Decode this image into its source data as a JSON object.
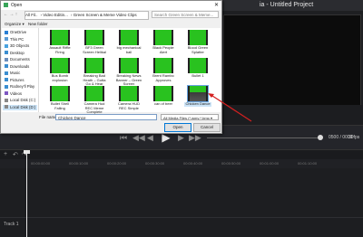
{
  "editor": {
    "title": "ia - Untitled Project",
    "timecode": "0500 / 0000",
    "speed": "30fps",
    "track_label": "Track 1",
    "ruler": [
      "00:00:00:00",
      "00:00:10:00",
      "00:00:20:00",
      "00:00:30:00",
      "00:00:40:00",
      "00:00:50:00",
      "00:01:00:00",
      "00:01:10:00"
    ]
  },
  "dialog": {
    "title": "Open",
    "address": [
      "All Fil..",
      "Video Editin...",
      "Green Screen & Meme Video Clips"
    ],
    "search_placeholder": "Search Green Screen & Meme...",
    "organize": "Organize ▾",
    "new_folder": "New folder",
    "nav": [
      {
        "label": "OneDrive",
        "color": "#2a7fd4"
      },
      {
        "label": "This PC",
        "color": "#5b9bd5"
      },
      {
        "label": "3D Objects",
        "color": "#4aa3df"
      },
      {
        "label": "Desktop",
        "color": "#3b8ed0"
      },
      {
        "label": "Documents",
        "color": "#6b8ebc"
      },
      {
        "label": "Downloads",
        "color": "#3b8ed0"
      },
      {
        "label": "Music",
        "color": "#3b8ed0"
      },
      {
        "label": "Pictures",
        "color": "#3b8ed0"
      },
      {
        "label": "Rodney'll Play",
        "color": "#3b8ed0"
      },
      {
        "label": "Videos",
        "color": "#7e57c2"
      },
      {
        "label": "Local Disk (C:)",
        "color": "#888888"
      },
      {
        "label": "Local Disk (D:)",
        "color": "#888888"
      }
    ],
    "files": [
      {
        "name": "Assault Riffle Firing",
        "person": false
      },
      {
        "name": "BF3 Green Screen Helikal",
        "person": false
      },
      {
        "name": "big mechanical ball",
        "person": false
      },
      {
        "name": "Black People Alert",
        "person": false
      },
      {
        "name": "Blood Green Splatter",
        "person": false
      },
      {
        "name": "Bus Bomb explosion",
        "person": false
      },
      {
        "name": "Breaking Bad Heath – Gotta Go & Hear",
        "person": false
      },
      {
        "name": "Breaking News Banner – Green Screen Animation",
        "person": false
      },
      {
        "name": "Brent Rambo Approves",
        "person": false
      },
      {
        "name": "Bullet 1",
        "person": false
      },
      {
        "name": "Bullet Shell Falling",
        "person": false
      },
      {
        "name": "Camera Hud REC Meme Complete",
        "person": false
      },
      {
        "name": "Camera HUD REC Simple",
        "person": false
      },
      {
        "name": "can of beer",
        "person": false
      },
      {
        "name": "Chicken Dance",
        "person": true
      }
    ],
    "file_name_label": "File name:",
    "file_name_value": "Chicken Dance",
    "file_type": "All Media Files (*.wmv;*.bmp ▾",
    "open_label": "Open",
    "cancel_label": "Cancel"
  },
  "colors": {
    "green_screen": "#29c21f",
    "arrow": "#d42020",
    "selection": "#cce4f7"
  }
}
